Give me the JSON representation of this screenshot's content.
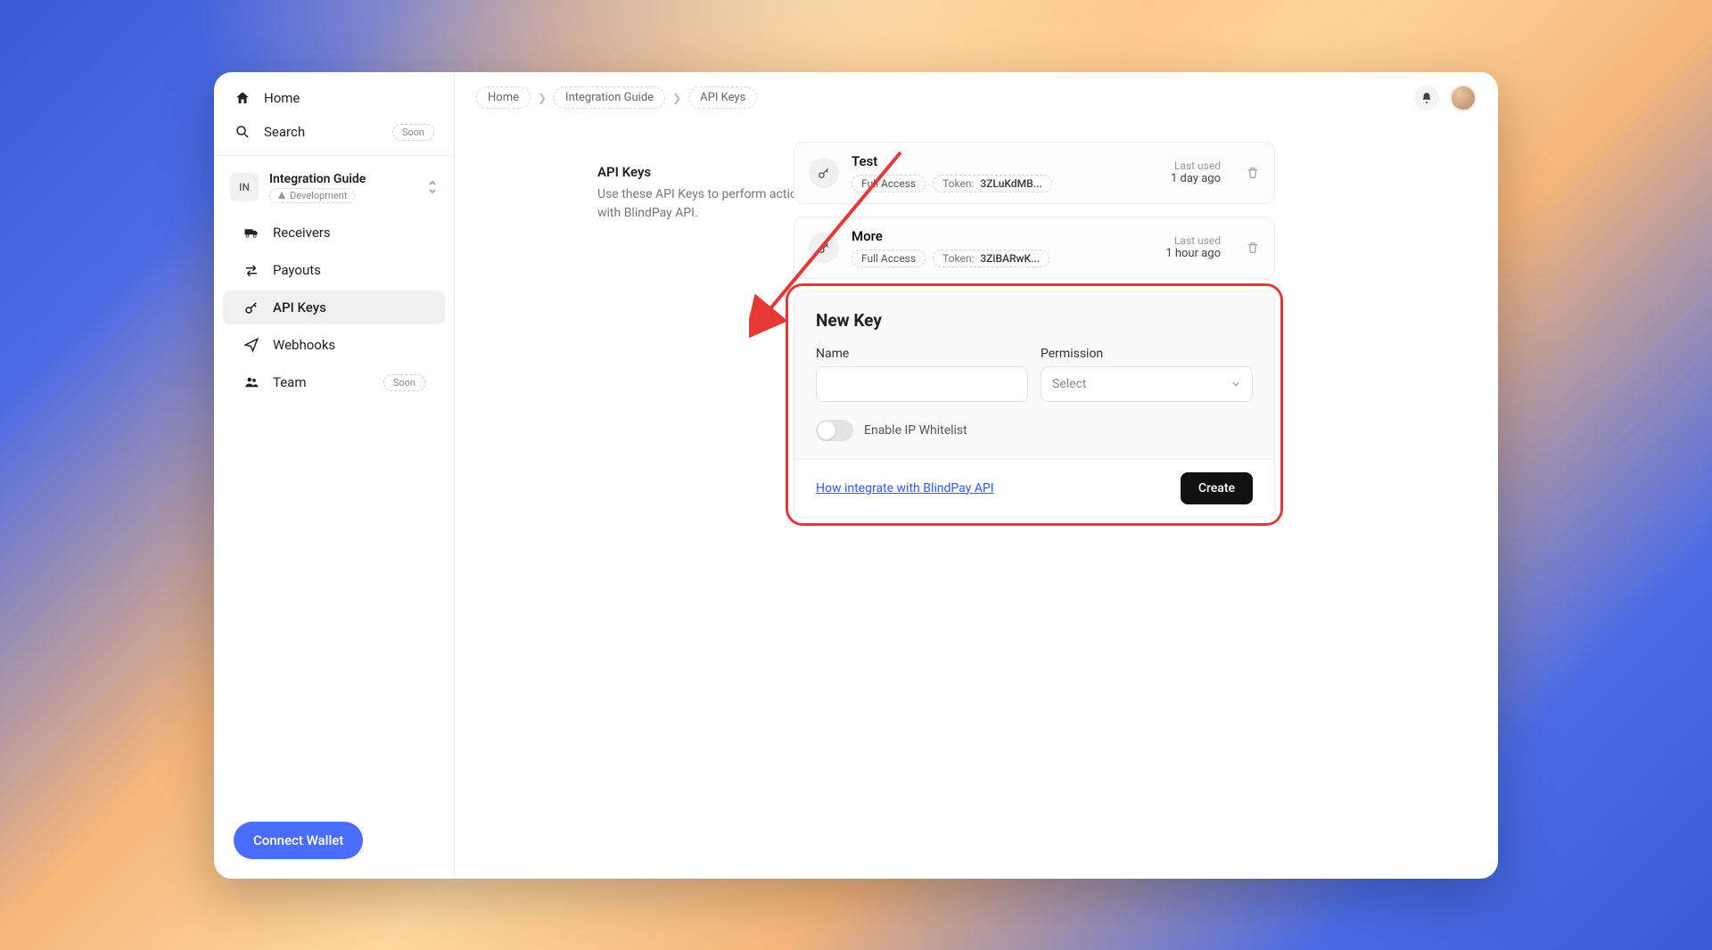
{
  "sidebar": {
    "home": "Home",
    "search": "Search",
    "soon": "Soon",
    "org": {
      "initials": "IN",
      "name": "Integration Guide",
      "env": "Development"
    },
    "items": [
      {
        "label": "Receivers"
      },
      {
        "label": "Payouts"
      },
      {
        "label": "API Keys"
      },
      {
        "label": "Webhooks"
      },
      {
        "label": "Team"
      }
    ],
    "connect": "Connect Wallet"
  },
  "breadcrumb": [
    "Home",
    "Integration Guide",
    "API Keys"
  ],
  "page": {
    "title": "API Keys",
    "desc": "Use these API Keys to perform actions with BlindPay API."
  },
  "keys": [
    {
      "name": "Test",
      "perm": "Full Access",
      "token_label": "Token:",
      "token": "3ZLuKdMB...",
      "last_label": "Last used",
      "last": "1 day ago"
    },
    {
      "name": "More",
      "perm": "Full Access",
      "token_label": "Token:",
      "token": "3ZiBARwK...",
      "last_label": "Last used",
      "last": "1 hour ago"
    }
  ],
  "newkey": {
    "title": "New Key",
    "name_label": "Name",
    "perm_label": "Permission",
    "perm_placeholder": "Select",
    "toggle_label": "Enable IP Whitelist",
    "help_link": "How integrate with BlindPay API",
    "create": "Create"
  }
}
